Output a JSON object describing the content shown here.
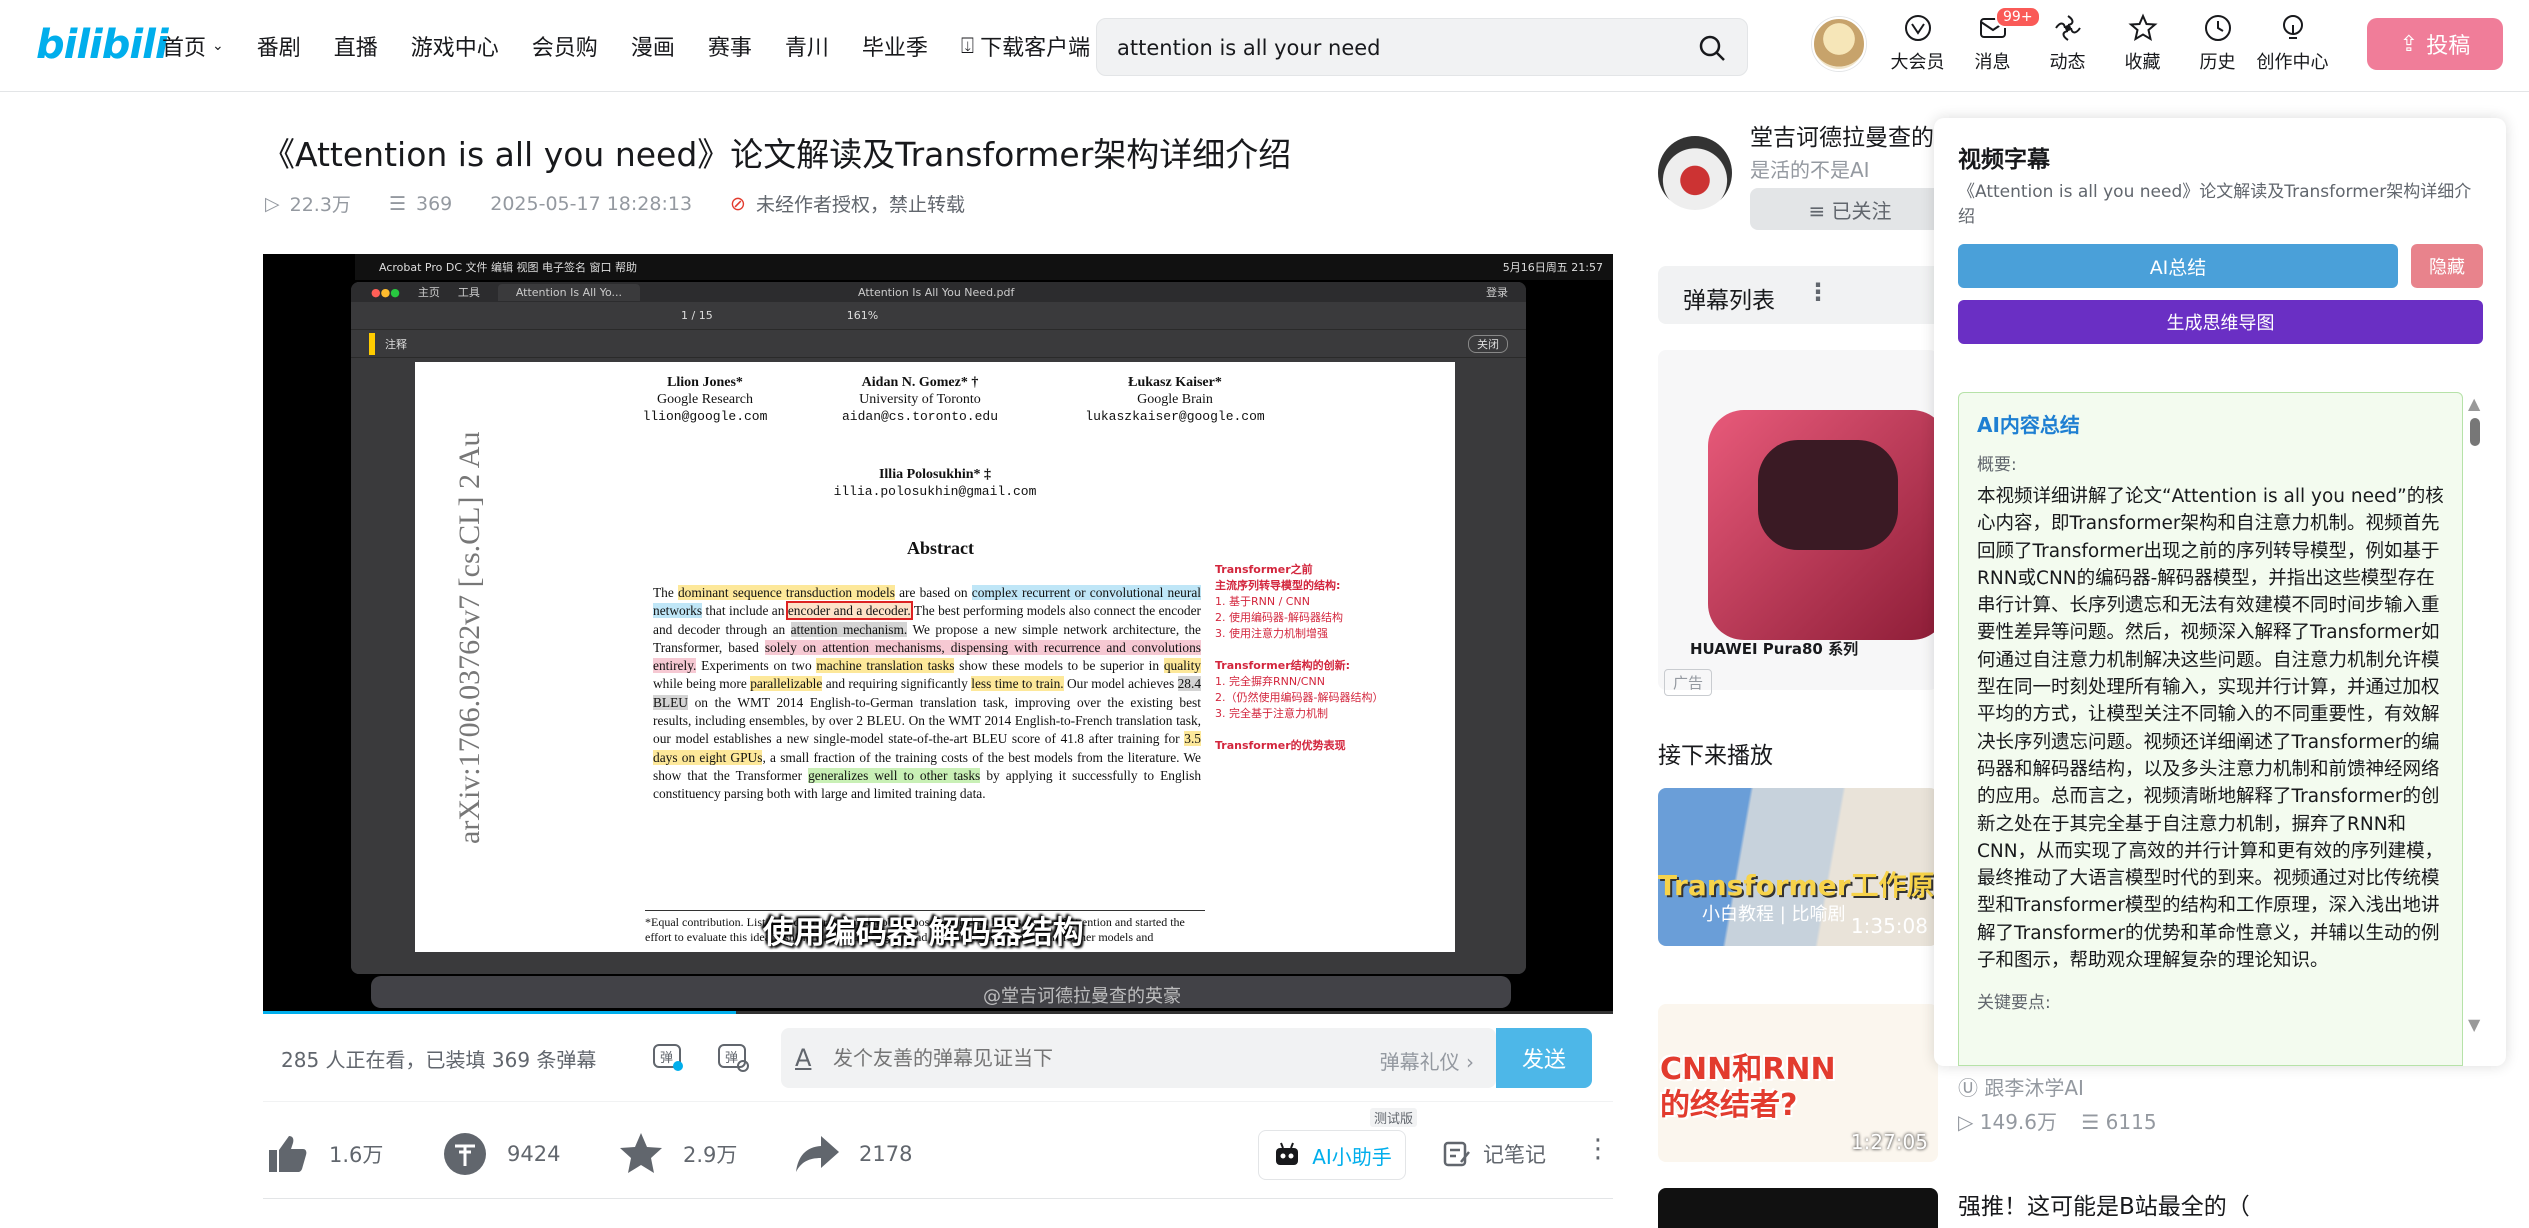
{
  "header": {
    "logo": "bilibili",
    "nav": [
      "首页",
      "番剧",
      "直播",
      "游戏中心",
      "会员购",
      "漫画",
      "赛事",
      "青川",
      "毕业季",
      "下载客户端"
    ],
    "search_value": "attention is all your need",
    "icons": [
      {
        "icon": "vip-icon",
        "label": "大会员"
      },
      {
        "icon": "message-icon",
        "label": "消息",
        "badge": "99+"
      },
      {
        "icon": "dynamic-icon",
        "label": "动态"
      },
      {
        "icon": "favorite-icon",
        "label": "收藏"
      },
      {
        "icon": "history-icon",
        "label": "历史"
      },
      {
        "icon": "creator-icon",
        "label": "创作中心"
      }
    ],
    "upload_label": "投稿"
  },
  "video": {
    "title": "《Attention is all you need》论文解读及Transformer架构详细介绍",
    "views": "22.3万",
    "danmaku_count": "369",
    "date": "2025-05-17 18:28:13",
    "copyright": "未经作者授权，禁止转载",
    "progress": 0.35
  },
  "player": {
    "menubar_left": "Acrobat Pro DC   文件   编辑   视图   电子签名   窗口   帮助",
    "menubar_right": "5月16日周五 21:57",
    "acro_tabs": [
      "主页",
      "工具",
      "Attention Is All Yo..."
    ],
    "pdf_file": "Attention Is All You Need.pdf",
    "page_indicator": "1 / 15",
    "zoom": "161%",
    "annot_label": "注释",
    "close_label": "关闭",
    "login_label": "登录",
    "arxiv": "arXiv:1706.03762v7  [cs.CL]  2 Au",
    "authors": [
      {
        "name": "Llion Jones*",
        "org": "Google Research",
        "email": "llion@google.com"
      },
      {
        "name": "Aidan N. Gomez* †",
        "org": "University of Toronto",
        "email": "aidan@cs.toronto.edu"
      },
      {
        "name": "Łukasz Kaiser*",
        "org": "Google Brain",
        "email": "lukaszkaiser@google.com"
      }
    ],
    "author4": {
      "name": "Illia Polosukhin* ‡",
      "email": "illia.polosukhin@gmail.com"
    },
    "abstract_title": "Abstract",
    "abstract_parts": [
      "The ",
      "dominant sequence transduction models",
      " are based on ",
      "complex recurrent or convolutional neural networks",
      " that include an ",
      "encoder and a decoder.",
      " The best performing models also connect the encoder and decoder through an ",
      "attention mechanism.",
      " We propose a new simple network architecture, the Transformer, based ",
      "solely on attention mechanisms, dispensing with recurrence and convolutions entirely.",
      " Experiments on two ",
      "machine translation tasks",
      " show these models to be superior in ",
      "quality",
      " while being more ",
      "parallelizable",
      " and requiring significantly ",
      "less time to train.",
      " Our model achieves ",
      "28.4 BLEU",
      " on the WMT 2014 English-to-German translation task, improving over the existing best results, including ensembles, by over 2 BLEU. On the WMT 2014 English-to-French translation task, our model establishes a new single-model state-of-the-art BLEU score of 41.8 after training for ",
      "3.5 days on eight GPUs",
      ", a small fraction of the training costs of the best models from the literature. We show that the Transformer ",
      "generalizes well to other tasks",
      " by applying it successfully to English constituency parsing both with large and limited training data."
    ],
    "notes": [
      "Transformer之前",
      "主流序列转导模型的结构:",
      "1. 基于RNN / CNN",
      "2. 使用编码器-解码器结构",
      "3. 使用注意力机制增强",
      "",
      "Transformer结构的创新:",
      "1. 完全摒弃RNN/CNN",
      "2.（仍然使用编码器-解码器结构）",
      "3. 完全基于注意力机制",
      "",
      "Transformer的优势表现"
    ],
    "footnote": "*Equal contribution. Listing order is random. Jakob proposed replacing RNNs with self-attention and started the effort to evaluate this idea. Ashish, with Illia, designed and implemented the first Transformer models and",
    "subtitle": "使用编码器 解码器结构",
    "watermark": "@堂吉诃德拉曼查的英豪"
  },
  "danmaku": {
    "status": "285 人正在看，已装填 369 条弹幕",
    "placeholder": "发个友善的弹幕见证当下",
    "etiquette": "弹幕礼仪 ›",
    "send": "发送"
  },
  "actions": {
    "like": "1.6万",
    "coin": "9424",
    "fav": "2.9万",
    "share": "2178",
    "ai_assistant": "AI小助手",
    "ai_tag": "测试版",
    "notes": "记笔记"
  },
  "uploader": {
    "name": "堂吉诃德拉曼查的",
    "desc": "是活的不是AI",
    "follow": "≡ 已关注"
  },
  "sidebar": {
    "danmaku_list": "弹幕列表",
    "ad_caption": "HUAWEI Pura80 系列",
    "ad_tag": "广告",
    "next_title": "接下来播放",
    "rec": [
      {
        "thumb_title": "Transformer工作原理",
        "thumb_sub": "小白教程 | 比喻剧",
        "duration": "1:35:08"
      },
      {
        "thumb_title": "CNN和RNN\n的终结者?",
        "duration": "1:27:05",
        "up": "跟李沐学AI",
        "views": "149.6万",
        "danmaku": "6115"
      },
      {
        "title": "强推！这可能是B站最全的（"
      }
    ]
  },
  "subtitle_panel": {
    "title": "视频字幕",
    "video_title": "《Attention is all you need》论文解读及Transformer架构详细介绍",
    "ai_summary_btn": "AI总结",
    "hide_btn": "隐藏",
    "mindmap_btn": "生成思维导图",
    "summary_heading": "AI内容总结",
    "overview_label": "概要:",
    "summary": "本视频详细讲解了论文“Attention is all you need”的核心内容，即Transformer架构和自注意力机制。视频首先回顾了Transformer出现之前的序列转导模型，例如基于RNN或CNN的编码器-解码器模型，并指出这些模型存在串行计算、长序列遗忘和无法有效建模不同时间步输入重要性差异等问题。然后，视频深入解释了Transformer如何通过自注意力机制解决这些问题。自注意力机制允许模型在同一时刻处理所有输入，实现并行计算，并通过加权平均的方式，让模型关注不同输入的不同重要性，有效解决长序列遗忘问题。视频还详细阐述了Transformer的编码器和解码器结构，以及多头注意力机制和前馈神经网络的应用。总而言之，视频清晰地解释了Transformer的创新之处在于其完全基于自注意力机制，摒弃了RNN和CNN，从而实现了高效的并行计算和更有效的序列建模，最终推动了大语言模型时代的到来。视频通过对比传统模型和Transformer模型的结构和工作原理，深入浅出地讲解了Transformer的优势和革命性意义，并辅以生动的例子和图示，帮助观众理解复杂的理论知识。",
    "keypoints_label": "关键要点:"
  },
  "colors": {
    "brand": "#00aeec",
    "pink": "#f07d99",
    "purple": "#6a2fc4"
  }
}
